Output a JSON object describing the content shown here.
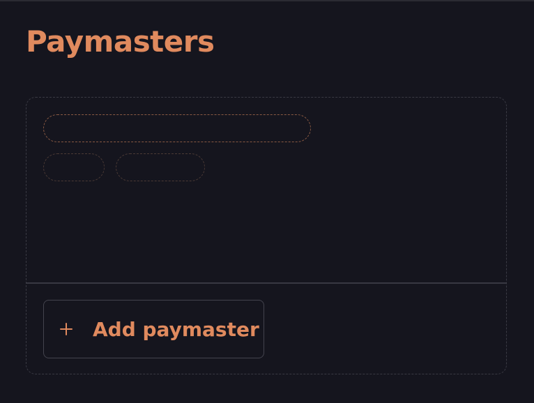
{
  "page": {
    "title": "Paymasters"
  },
  "card": {
    "add_button": {
      "label": "Add paymaster",
      "icon": "plus-icon"
    }
  },
  "colors": {
    "background": "#15151e",
    "accent": "#e08a5e",
    "border": "#3a3a44"
  }
}
